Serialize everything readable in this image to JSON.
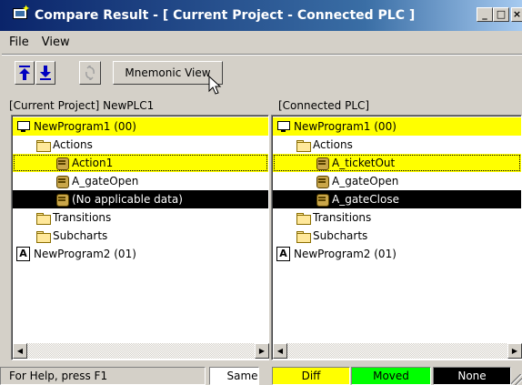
{
  "window": {
    "title": "Compare Result - [ Current Project - Connected PLC ]",
    "controls": [
      "minimize",
      "maximize",
      "close"
    ]
  },
  "menu": [
    {
      "label": "File"
    },
    {
      "label": "View"
    }
  ],
  "toolbar": {
    "prev_diff_icon": "arrow-up-to-bar-icon",
    "next_diff_icon": "arrow-down-to-bar-icon",
    "sync_icon": "sync-scroll-icon",
    "mnemonic_label": "Mnemonic View"
  },
  "left_pane": {
    "header": "[Current Project] NewPLC1",
    "rows": [
      {
        "label": "NewProgram1 (00)",
        "icon": "program-icon",
        "state": "diff"
      },
      {
        "label": "Actions",
        "icon": "folder-icon",
        "state": "same"
      },
      {
        "label": "Action1",
        "icon": "action-icon",
        "state": "diff"
      },
      {
        "label": "A_gateOpen",
        "icon": "action-icon",
        "state": "same"
      },
      {
        "label": "(No applicable data)",
        "icon": "action-icon",
        "state": "none"
      },
      {
        "label": "Transitions",
        "icon": "folder-icon",
        "state": "same"
      },
      {
        "label": "Subcharts",
        "icon": "folder-icon",
        "state": "same"
      },
      {
        "label": "NewProgram2 (01)",
        "icon": "sfc-program-icon",
        "state": "same"
      }
    ]
  },
  "right_pane": {
    "header": "[Connected PLC]",
    "rows": [
      {
        "label": "NewProgram1 (00)",
        "icon": "program-icon",
        "state": "diff"
      },
      {
        "label": "Actions",
        "icon": "folder-icon",
        "state": "same"
      },
      {
        "label": "A_ticketOut",
        "icon": "action-icon",
        "state": "diff"
      },
      {
        "label": "A_gateOpen",
        "icon": "action-icon",
        "state": "same"
      },
      {
        "label": "A_gateClose",
        "icon": "action-icon",
        "state": "none"
      },
      {
        "label": "Transitions",
        "icon": "folder-icon",
        "state": "same"
      },
      {
        "label": "Subcharts",
        "icon": "folder-icon",
        "state": "same"
      },
      {
        "label": "NewProgram2 (01)",
        "icon": "sfc-program-icon",
        "state": "same"
      }
    ]
  },
  "status": {
    "help": "For Help, press F1",
    "legend": {
      "same": "Same",
      "diff": "Diff",
      "moved": "Moved",
      "none": "None"
    }
  },
  "colors": {
    "diff": "#ffff00",
    "moved": "#00ff00",
    "none": "#000000",
    "same": "#ffffff"
  }
}
